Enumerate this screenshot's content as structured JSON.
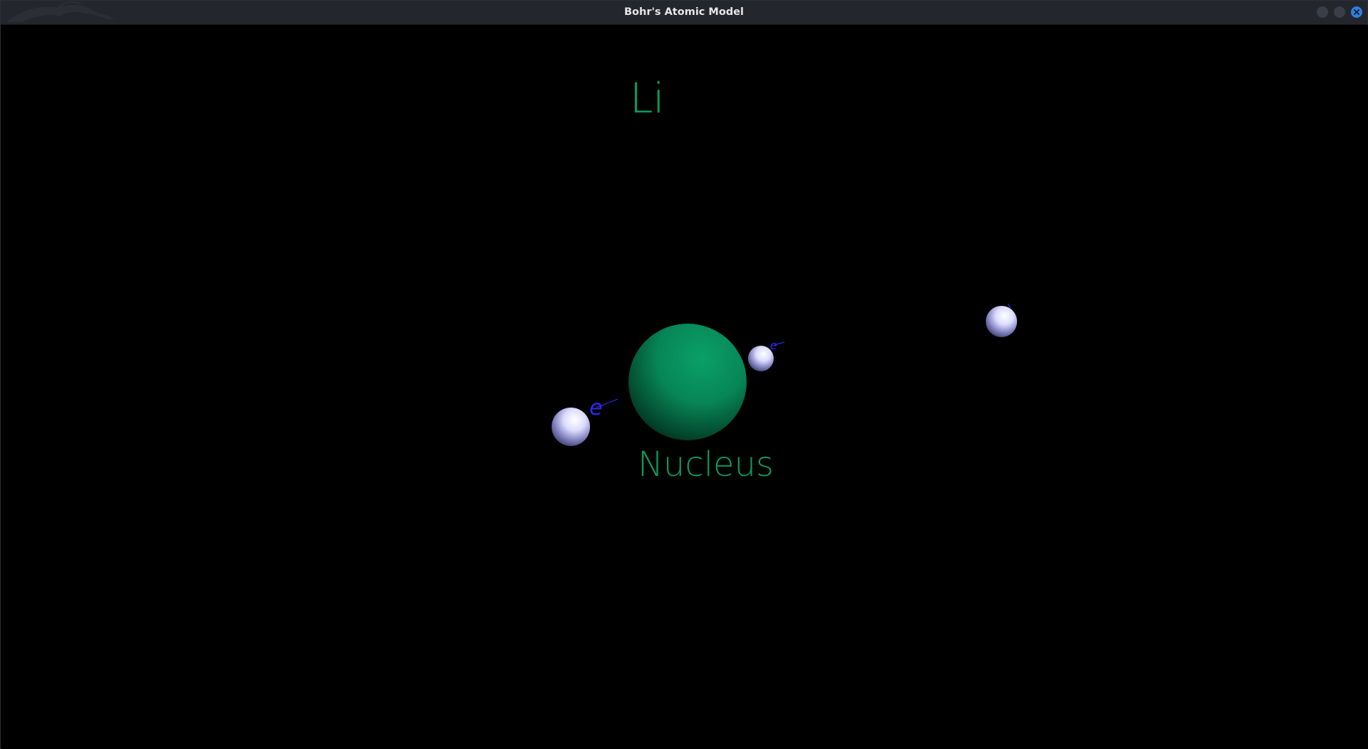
{
  "window": {
    "title": "Bohr's Atomic Model",
    "controls": [
      "minimize",
      "maximize",
      "close"
    ],
    "close_color": "#2f7fe0"
  },
  "scene": {
    "element_symbol": "Li",
    "nucleus_label": "Nucleus",
    "electron_label": "e",
    "label_color": "#0b9a5e",
    "nucleus_color": "#0b8f5a",
    "electron_label_color": "#2a2af0",
    "electron_color": "#e8e8ff"
  }
}
